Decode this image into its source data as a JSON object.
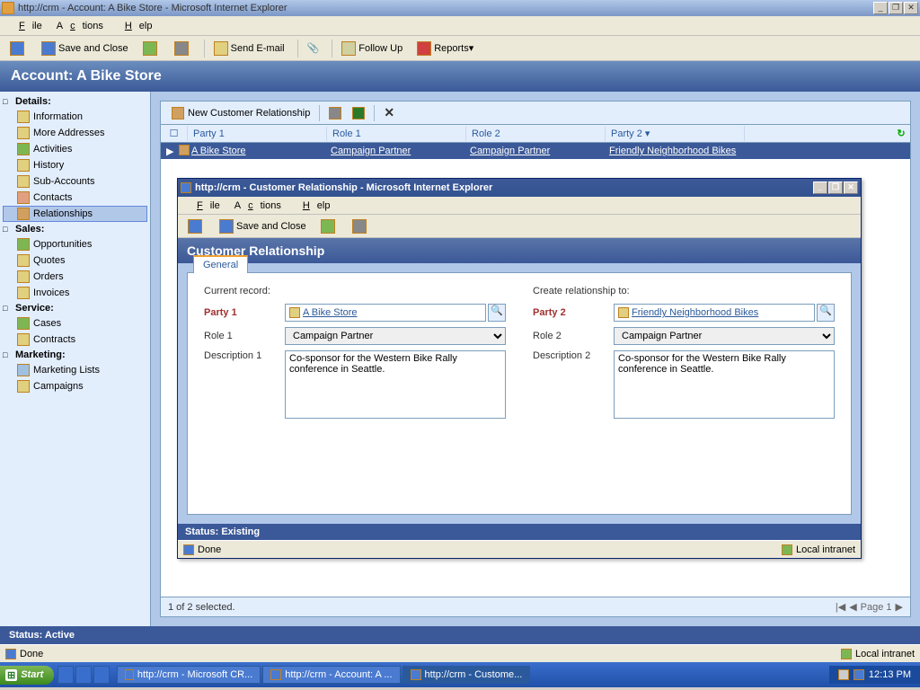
{
  "window": {
    "title": "http://crm - Account: A Bike Store - Microsoft Internet Explorer"
  },
  "menu": {
    "file": "File",
    "actions": "Actions",
    "help": "Help"
  },
  "toolbar": {
    "save_close": "Save and Close",
    "send_email": "Send E-mail",
    "follow_up": "Follow Up",
    "reports": "Reports"
  },
  "banner": "Account: A Bike Store",
  "sidebar": {
    "groups": [
      {
        "title": "Details:",
        "items": [
          "Information",
          "More Addresses",
          "Activities",
          "History",
          "Sub-Accounts",
          "Contacts",
          "Relationships"
        ]
      },
      {
        "title": "Sales:",
        "items": [
          "Opportunities",
          "Quotes",
          "Orders",
          "Invoices"
        ]
      },
      {
        "title": "Service:",
        "items": [
          "Cases",
          "Contracts"
        ]
      },
      {
        "title": "Marketing:",
        "items": [
          "Marketing Lists",
          "Campaigns"
        ]
      }
    ],
    "selected": "Relationships"
  },
  "content_toolbar": {
    "new": "New Customer Relationship"
  },
  "grid": {
    "cols": [
      "Party 1",
      "Role 1",
      "Role 2",
      "Party 2"
    ],
    "row": {
      "party1": "A Bike Store",
      "role1": "Campaign Partner",
      "role2": "Campaign Partner",
      "party2": "Friendly Neighborhood Bikes"
    }
  },
  "content_footer": {
    "selection": "1 of 2 selected.",
    "page": "Page 1"
  },
  "popup": {
    "title": "http://crm - Customer Relationship - Microsoft Internet Explorer",
    "banner": "Customer Relationship",
    "tab": "General",
    "left_header": "Current record:",
    "right_header": "Create relationship to:",
    "labels": {
      "party1": "Party 1",
      "role1": "Role 1",
      "desc1": "Description 1",
      "party2": "Party 2",
      "role2": "Role 2",
      "desc2": "Description 2"
    },
    "values": {
      "party1": "A Bike Store",
      "role1": "Campaign Partner",
      "desc1": "Co-sponsor for the Western Bike Rally conference in Seattle.",
      "party2": "Friendly Neighborhood Bikes",
      "role2": "Campaign Partner",
      "desc2": "Co-sponsor for the Western Bike Rally conference in Seattle."
    },
    "status": "Status: Existing",
    "done": "Done",
    "zone": "Local intranet"
  },
  "outer_status": "Status: Active",
  "ie_status": {
    "done": "Done",
    "zone": "Local intranet"
  },
  "taskbar": {
    "start": "Start",
    "tasks": [
      "http://crm - Microsoft CR...",
      "http://crm - Account: A ...",
      "http://crm - Custome..."
    ],
    "time": "12:13 PM"
  }
}
